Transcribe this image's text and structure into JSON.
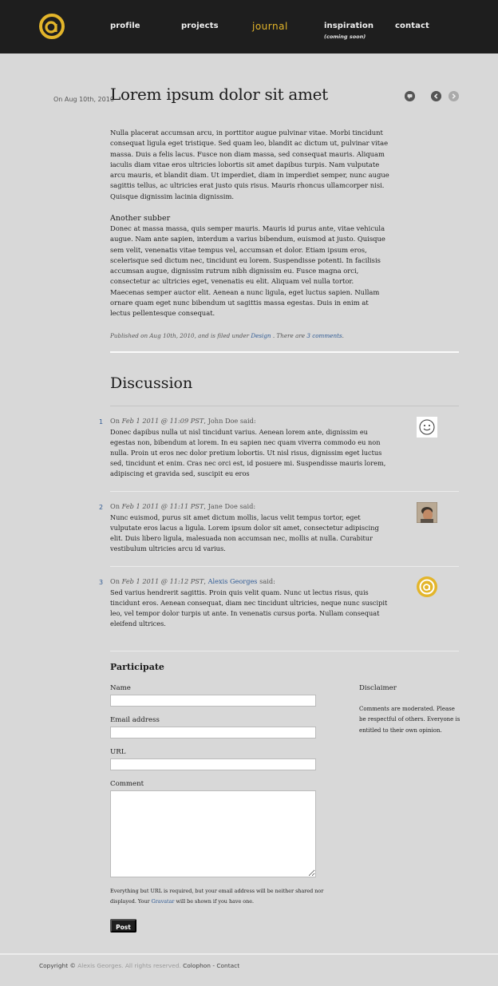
{
  "colors": {
    "accent": "#e3b52a",
    "header_bg": "#1e1e1e",
    "page_bg": "#d8d8d8",
    "link": "#2f5a93"
  },
  "nav": {
    "profile": "profile",
    "projects": "projects",
    "journal": "journal",
    "inspiration": "inspiration",
    "inspiration_sub": "(coming soon)",
    "contact": "contact"
  },
  "post": {
    "date": "On Aug 10th, 2010",
    "title": "Lorem ipsum dolor sit amet",
    "para1": "Nulla placerat accumsan arcu, in porttitor augue pulvinar vitae. Morbi tincidunt consequat ligula eget tristique. Sed quam leo, blandit ac dictum ut, pulvinar vitae massa. Duis a felis lacus. Fusce non diam massa, sed consequat mauris. Aliquam iaculis diam vitae eros ultricies lobortis sit amet dapibus turpis. Nam vulputate arcu mauris, et blandit diam. Ut imperdiet, diam in imperdiet semper, nunc augue sagittis tellus, ac ultricies erat justo quis risus. Mauris rhoncus ullamcorper nisi. Quisque dignissim lacinia dignissim.",
    "subhead": "Another subber",
    "para2": "Donec at massa massa, quis semper mauris. Mauris id purus ante, vitae vehicula augue. Nam ante sapien, interdum a varius bibendum, euismod at justo. Quisque sem velit, venenatis vitae tempus vel, accumsan et dolor. Etiam ipsum eros, scelerisque sed dictum nec, tincidunt eu lorem. Suspendisse potenti. In facilisis accumsan augue, dignissim rutrum nibh dignissim eu. Fusce magna orci, consectetur ac ultricies eget, venenatis eu elit. Aliquam vel nulla tortor. Maecenas semper auctor elit. Aenean a nunc ligula, eget luctus sapien. Nullam ornare quam eget nunc bibendum ut sagittis massa egestas. Duis in enim at lectus pellentesque consequat.",
    "meta_prefix": "Published on Aug 10th, 2010, and is filed under",
    "meta_category": "Design",
    "meta_middle": ". There are",
    "meta_comments": "3 comments",
    "meta_end": "."
  },
  "discussion": {
    "title": "Discussion",
    "comments": [
      {
        "num": "1",
        "on": "On",
        "date": "Feb 1 2011 @ 11:09 PST",
        "author": "John Doe",
        "said": "said:",
        "text": "Donec dapibus nulla ut nisl tincidunt varius. Aenean lorem ante, dignissim eu egestas non, bibendum at lorem. In eu sapien nec quam viverra commodo eu non nulla. Proin ut eros nec dolor pretium lobortis. Ut nisl risus, dignissim eget luctus sed, tincidunt et enim. Cras nec orci est, id posuere mi. Suspendisse mauris lorem, adipiscing et gravida sed, suscipit eu eros"
      },
      {
        "num": "2",
        "on": "On",
        "date": "Feb 1 2011 @ 11:11 PST",
        "author": "Jane Doe",
        "said": "said:",
        "text": "Nunc euismod, purus sit amet dictum mollis, lacus velit tempus tortor, eget vulputate eros lacus a ligula. Lorem ipsum dolor sit amet, consectetur adipiscing elit. Duis libero ligula, malesuada non accumsan nec, mollis at nulla. Curabitur vestibulum ultricies arcu id varius."
      },
      {
        "num": "3",
        "on": "On",
        "date": "Feb 1 2011 @ 11:12 PST",
        "author": "Alexis Georges",
        "said": "said:",
        "text": "Sed varius hendrerit sagittis. Proin quis velit quam. Nunc ut lectus risus, quis tincidunt eros. Aenean consequat, diam nec tincidunt ultricies, neque nunc suscipit leo, vel tempor dolor turpis ut ante. In venenatis cursus porta. Nullam consequat eleifend ultrices."
      }
    ]
  },
  "form": {
    "title": "Participate",
    "name_label": "Name",
    "email_label": "Email address",
    "url_label": "URL",
    "comment_label": "Comment",
    "note_a": "Everything but URL is required, but your email address will be neither shared nor displayed. Your",
    "note_link": "Gravatar",
    "note_b": "will be shown if you have one.",
    "post_label": "Post"
  },
  "sidebar": {
    "disclaimer_label": "Disclaimer",
    "disclaimer_text": "Comments are moderated. Please be respectful of others. Everyone is entitled to their own opinion."
  },
  "footer": {
    "copyright": "Copyright ©",
    "owner": "Alexis Georges. All rights reserved.",
    "colophon": "Colophon",
    "sep": "-",
    "contact": "Contact"
  }
}
